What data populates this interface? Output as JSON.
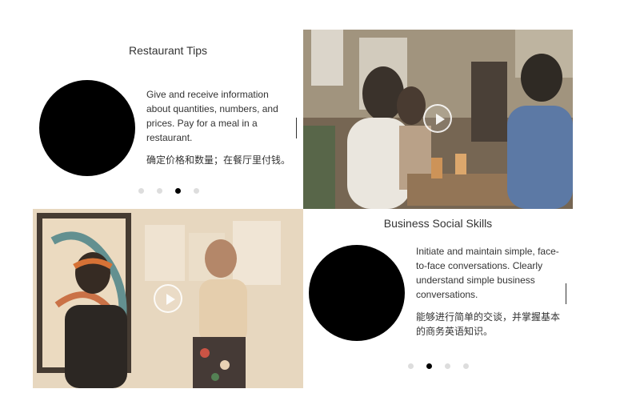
{
  "cards": [
    {
      "title": "Restaurant Tips",
      "desc_en": "Give and receive information about quantities, numbers, and prices. Pay for a meal in a restaurant.",
      "desc_zh": "确定价格和数量；在餐厅里付钱。",
      "dots": [
        {
          "active": false
        },
        {
          "active": false
        },
        {
          "active": true
        },
        {
          "active": false
        }
      ]
    },
    {
      "title": "Business Social Skills",
      "desc_en": "Initiate and maintain simple, face-to-face conversations. Clearly understand simple business conversations.",
      "desc_zh": "能够进行简单的交谈，并掌握基本的商务英语知识。",
      "dots": [
        {
          "active": false
        },
        {
          "active": true
        },
        {
          "active": false
        },
        {
          "active": false
        }
      ]
    }
  ],
  "photos": [
    {
      "icon": "play-icon"
    },
    {
      "icon": "play-icon"
    }
  ],
  "colors": {
    "active_dot": "#000000",
    "inactive_dot": "#dddddd",
    "text": "#333333"
  }
}
